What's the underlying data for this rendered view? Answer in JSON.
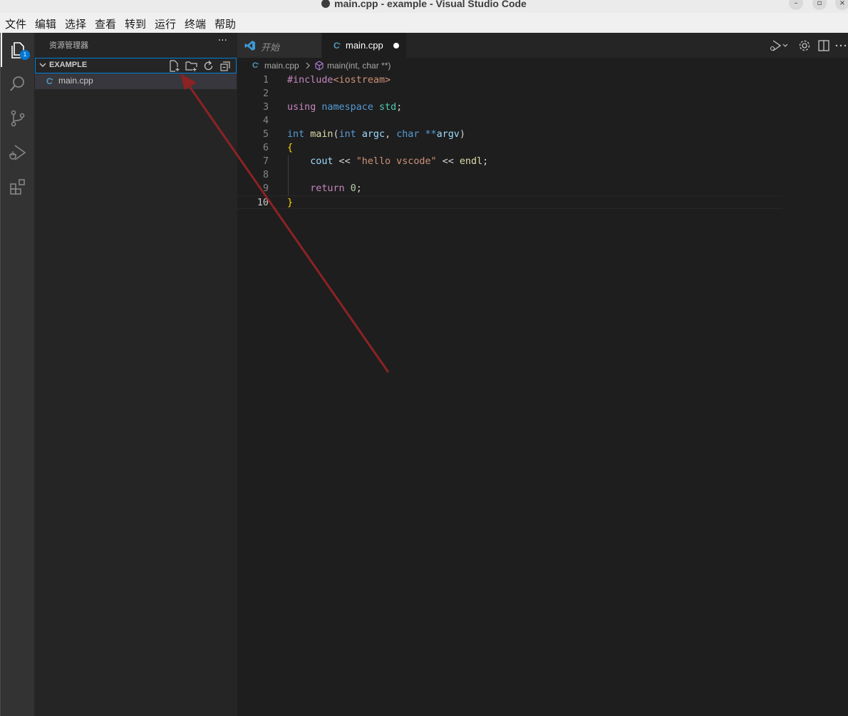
{
  "window": {
    "title": "main.cpp - example - Visual Studio Code"
  },
  "menu": [
    "文件",
    "编辑",
    "选择",
    "查看",
    "转到",
    "运行",
    "终端",
    "帮助"
  ],
  "activity_bar": {
    "items": [
      "explorer-icon",
      "search-icon",
      "source-control-icon",
      "run-debug-icon",
      "extensions-icon"
    ],
    "explorer_badge": "1"
  },
  "sidebar": {
    "title": "资源管理器",
    "more": "···",
    "section": "EXAMPLE",
    "section_tools": [
      "new-file-icon",
      "new-folder-icon",
      "refresh-icon",
      "collapse-all-icon"
    ],
    "files": [
      {
        "name": "main.cpp"
      }
    ]
  },
  "tabs": [
    {
      "label": "开始",
      "italic": true
    },
    {
      "label": "main.cpp",
      "active": true,
      "dirty": true
    }
  ],
  "breadcrumb": {
    "file": "main.cpp",
    "symbol": "main(int, char **)"
  },
  "editor": {
    "current_line": 10,
    "lines": [
      {
        "n": "1",
        "tokens": [
          [
            "k-pre",
            "#include"
          ],
          [
            "k-str",
            "<iostream>"
          ]
        ]
      },
      {
        "n": "2",
        "tokens": []
      },
      {
        "n": "3",
        "tokens": [
          [
            "k-pre",
            "using"
          ],
          [
            "k-txt",
            " "
          ],
          [
            "k-blue",
            "namespace"
          ],
          [
            "k-txt",
            " "
          ],
          [
            "k-type",
            "std"
          ],
          [
            "k-txt",
            ";"
          ]
        ]
      },
      {
        "n": "4",
        "tokens": []
      },
      {
        "n": "5",
        "tokens": [
          [
            "k-blue",
            "int"
          ],
          [
            "k-txt",
            " "
          ],
          [
            "k-fn",
            "main"
          ],
          [
            "k-txt",
            "("
          ],
          [
            "k-blue",
            "int"
          ],
          [
            "k-txt",
            " "
          ],
          [
            "k-var",
            "argc"
          ],
          [
            "k-txt",
            ", "
          ],
          [
            "k-blue",
            "char"
          ],
          [
            "k-txt",
            " "
          ],
          [
            "k-blue",
            "**"
          ],
          [
            "k-var",
            "argv"
          ],
          [
            "k-txt",
            ")"
          ]
        ]
      },
      {
        "n": "6",
        "tokens": [
          [
            "k-brace",
            "{"
          ]
        ]
      },
      {
        "n": "7",
        "tokens": [
          [
            "k-txt",
            "    "
          ],
          [
            "k-var",
            "cout"
          ],
          [
            "k-txt",
            " << "
          ],
          [
            "k-str",
            "\"hello vscode\""
          ],
          [
            "k-txt",
            " << "
          ],
          [
            "k-fn",
            "endl"
          ],
          [
            "k-txt",
            ";"
          ]
        ]
      },
      {
        "n": "8",
        "tokens": []
      },
      {
        "n": "9",
        "tokens": [
          [
            "k-txt",
            "    "
          ],
          [
            "k-pre",
            "return"
          ],
          [
            "k-txt",
            " "
          ],
          [
            "k-num",
            "0"
          ],
          [
            "k-txt",
            ";"
          ]
        ]
      },
      {
        "n": "10",
        "tokens": [
          [
            "k-brace",
            "}"
          ]
        ]
      }
    ]
  },
  "colors": {
    "accent": "#007fd4",
    "annotation_arrow": "#8b2323",
    "badge": "#0078d4"
  }
}
